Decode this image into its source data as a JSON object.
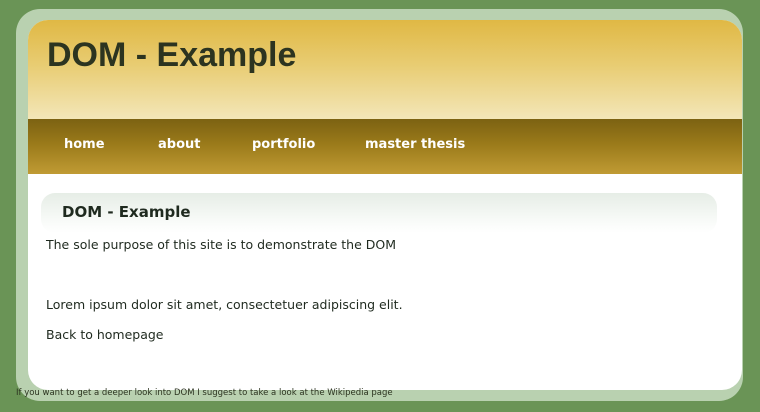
{
  "header": {
    "title": "DOM - Example"
  },
  "nav": {
    "items": [
      {
        "label": "home"
      },
      {
        "label": "about"
      },
      {
        "label": "portfolio"
      },
      {
        "label": "master thesis"
      }
    ]
  },
  "content": {
    "heading": "DOM - Example",
    "intro": "The sole purpose of this site is to demonstrate the DOM",
    "lorem": "Lorem ipsum dolor sit amet, consectetuer adipiscing elit.",
    "back_link": "Back to homepage"
  },
  "footer": {
    "note": "If you want to get a deeper look into DOM I suggest to take a look at the Wikipedia page"
  },
  "colors": {
    "background": "#6a9456",
    "frame": "#b9d1b0",
    "header_gold": "#e0b844",
    "nav_brown": "#8a6d15"
  }
}
